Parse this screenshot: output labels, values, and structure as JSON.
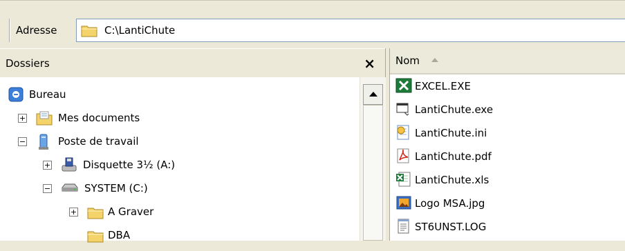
{
  "address_bar": {
    "label": "Adresse",
    "path": "C:\\LantiChute"
  },
  "folders_pane": {
    "title": "Dossiers",
    "close_symbol": "×",
    "tree": [
      {
        "label": "Bureau",
        "icon": "desktop-icon"
      },
      {
        "label": "Mes documents",
        "icon": "my-documents-icon",
        "expander": "+"
      },
      {
        "label": "Poste de travail",
        "icon": "my-computer-icon",
        "expander": "−"
      },
      {
        "label": "Disquette 3½ (A:)",
        "icon": "floppy-drive-icon",
        "expander": "+"
      },
      {
        "label": "SYSTEM (C:)",
        "icon": "hard-drive-icon",
        "expander": "−"
      },
      {
        "label": "A Graver",
        "icon": "folder-icon",
        "expander": "+"
      },
      {
        "label": "DBA",
        "icon": "folder-icon"
      }
    ]
  },
  "files_pane": {
    "column_header": "Nom",
    "files": [
      {
        "name": "EXCEL.EXE",
        "icon": "excel-app-icon"
      },
      {
        "name": "LantiChute.exe",
        "icon": "executable-icon"
      },
      {
        "name": "LantiChute.ini",
        "icon": "config-file-icon"
      },
      {
        "name": "LantiChute.pdf",
        "icon": "pdf-file-icon"
      },
      {
        "name": "LantiChute.xls",
        "icon": "excel-file-icon"
      },
      {
        "name": "Logo MSA.jpg",
        "icon": "image-file-icon"
      },
      {
        "name": "ST6UNST.LOG",
        "icon": "text-file-icon"
      }
    ]
  },
  "colors": {
    "folder": "#f5d36b",
    "excel_green": "#1d7b3a",
    "pdf_red": "#d42a1e"
  }
}
